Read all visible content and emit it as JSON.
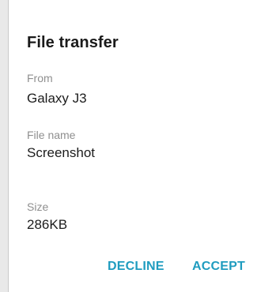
{
  "dialog": {
    "title": "File transfer",
    "from_label": "From",
    "from_value": "Galaxy J3",
    "file_name_label": "File name",
    "file_name_value": "Screenshot",
    "size_label": "Size",
    "size_value": "286KB",
    "decline_label": "DECLINE",
    "accept_label": "ACCEPT"
  },
  "colors": {
    "accent": "#1f9cbf",
    "background": "#ffffff",
    "label_gray": "#8f8f8f"
  }
}
